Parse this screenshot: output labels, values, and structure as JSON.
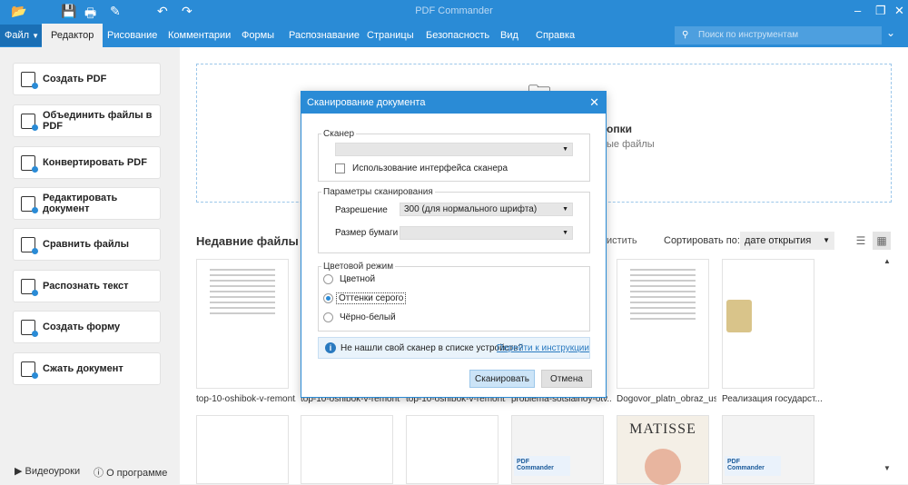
{
  "app": {
    "title": "PDF Commander"
  },
  "menu": {
    "file": "Файл",
    "items": [
      "Редактор",
      "Рисование",
      "Комментарии",
      "Формы",
      "Распознавание",
      "Страницы",
      "Безопасность",
      "Вид",
      "Справка"
    ],
    "active_index": 0,
    "search_placeholder": "Поиск по инструментам"
  },
  "sidebar": {
    "buttons": [
      {
        "label": "Создать PDF",
        "icon": "create-pdf-icon"
      },
      {
        "label": "Объединить файлы в PDF",
        "icon": "merge-files-icon"
      },
      {
        "label": "Конвертировать PDF",
        "icon": "convert-pdf-icon"
      },
      {
        "label": "Редактировать документ",
        "icon": "edit-document-icon"
      },
      {
        "label": "Сравнить файлы",
        "icon": "compare-files-icon"
      },
      {
        "label": "Распознать текст",
        "icon": "ocr-icon"
      },
      {
        "label": "Создать форму",
        "icon": "create-form-icon"
      },
      {
        "label": "Сжать документ",
        "icon": "compress-icon"
      }
    ],
    "footer": {
      "video": "Видеоуроки",
      "about": "О программе"
    }
  },
  "main": {
    "dropzone": {
      "line1": "опки",
      "line2": "ые файлы"
    },
    "recent_title": "Недавние файлы",
    "clear_label": "истить",
    "sort_label": "Сортировать по:",
    "sort_value": "дате открытия",
    "files": [
      "top-10-oshibok-v-remont...",
      "top-10-oshibok-v-remont...",
      "top-10-oshibok-v-remont...",
      "problema-sotsialnoy-otv...",
      "Dogovor_platn_obraz_us...",
      "Реализация государст..."
    ],
    "row2": {
      "matisse": "MATISSE",
      "pdf_commander": "PDF Commander"
    }
  },
  "dialog": {
    "title": "Сканирование документа",
    "scanner_group": "Сканер",
    "scanner_value": "",
    "use_interface": "Использование интерфейса сканера",
    "params_group": "Параметры сканирования",
    "resolution_label": "Разрешение",
    "resolution_value": "300 (для нормального шрифта)",
    "paper_label": "Размер бумаги",
    "paper_value": "",
    "color_group": "Цветовой режим",
    "color_options": [
      "Цветной",
      "Оттенки серого",
      "Чёрно-белый"
    ],
    "color_selected": 1,
    "info_text": "Не нашли свой сканер в списке устройств?",
    "info_link": "Перейти к инструкции",
    "scan_button": "Сканировать",
    "cancel_button": "Отмена"
  }
}
